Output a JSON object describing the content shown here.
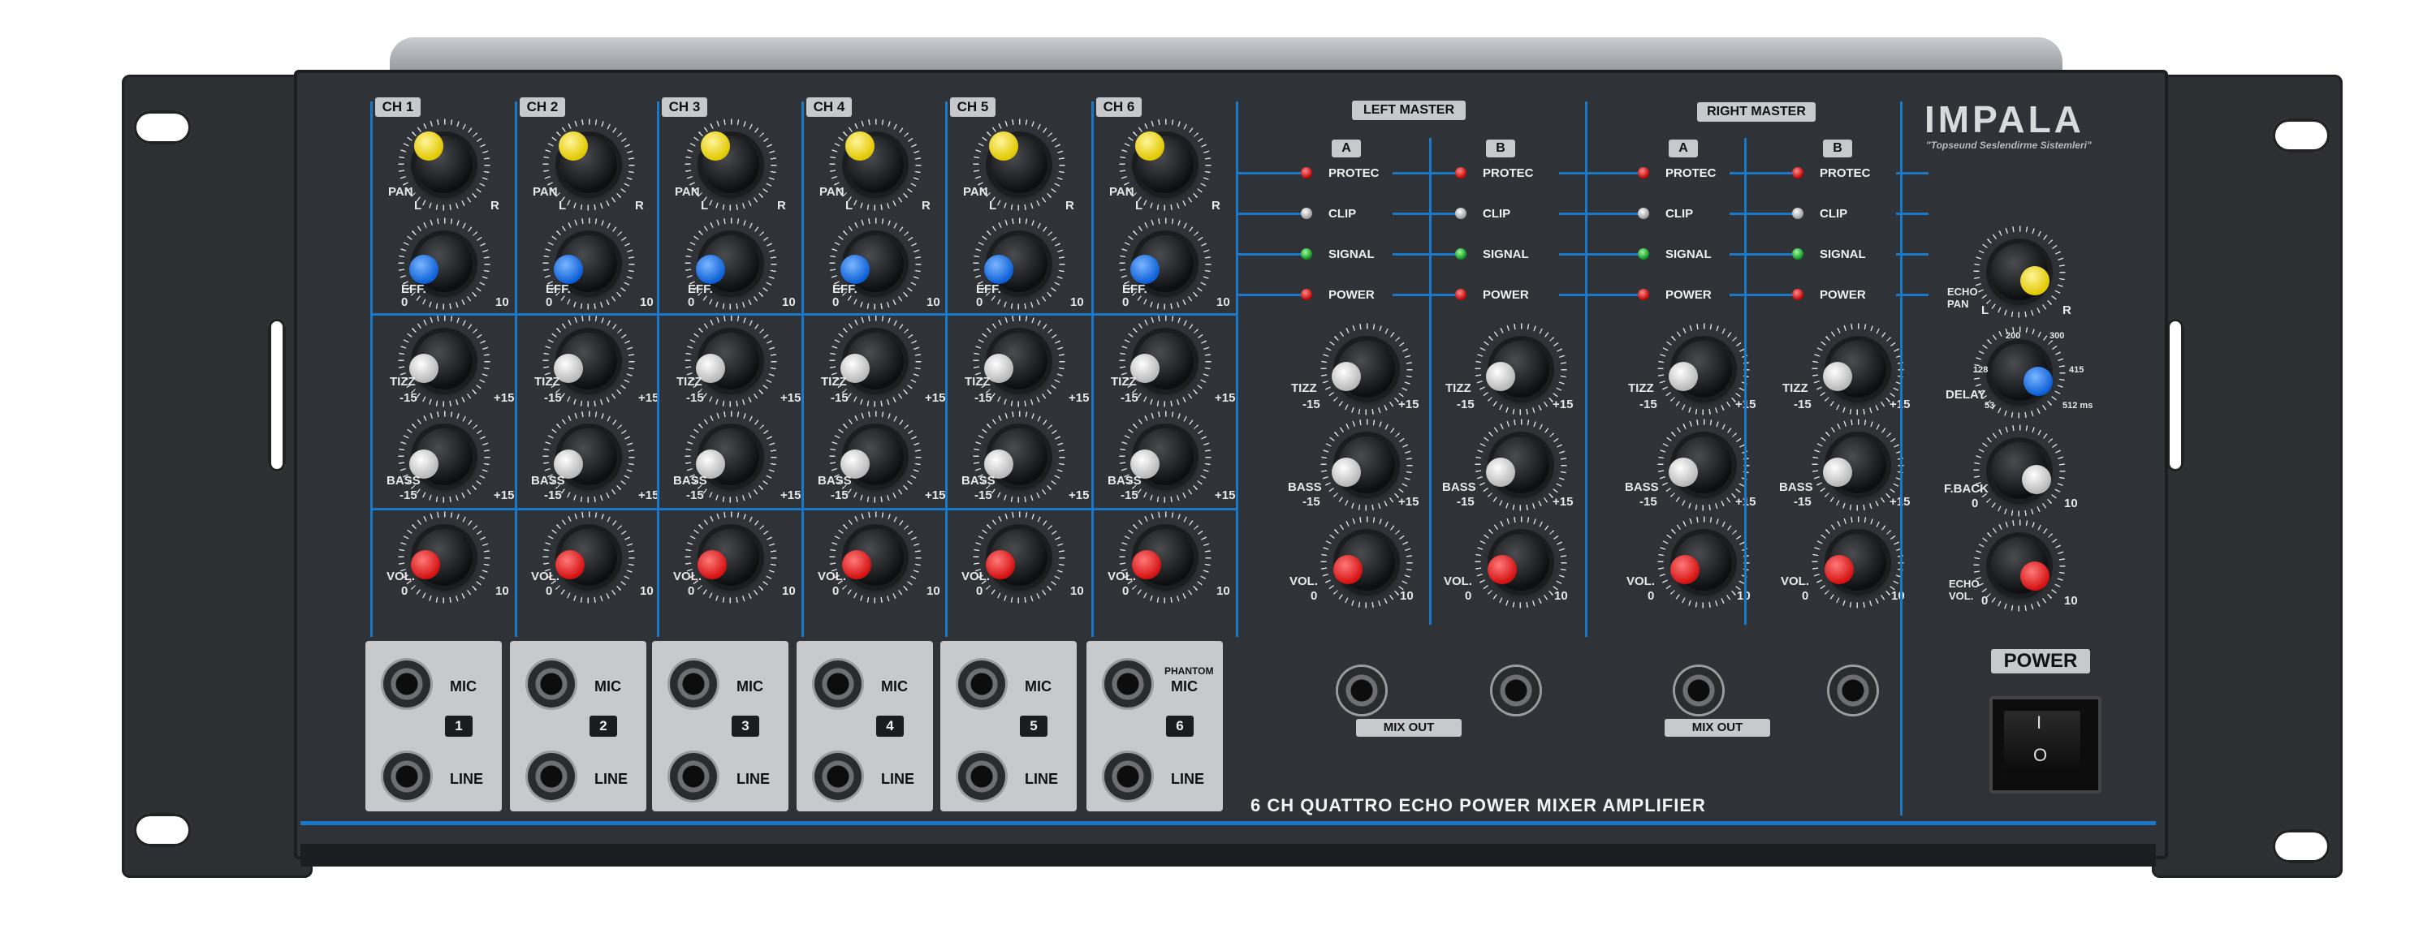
{
  "brand": {
    "name": "IMPALA",
    "tagline": "\"Topseund Seslendirme Sistemleri\""
  },
  "model_label": "6 CH QUATTRO ECHO POWER MIXER AMPLIFIER",
  "colors": {
    "panel": "#2f3236",
    "accent_blue": "#1a78c8",
    "label_plate": "#c7c9cc"
  },
  "channels": [
    {
      "label": "CH 1",
      "number": "1"
    },
    {
      "label": "CH 2",
      "number": "2"
    },
    {
      "label": "CH 3",
      "number": "3"
    },
    {
      "label": "CH 4",
      "number": "4"
    },
    {
      "label": "CH 5",
      "number": "5"
    },
    {
      "label": "CH 6",
      "number": "6"
    }
  ],
  "channel_controls": {
    "pan": "PAN",
    "pan_left": "L",
    "pan_right": "R",
    "eff": "EFF.",
    "eff_min": "0",
    "eff_max": "10",
    "tizz": "TIZZ",
    "bass": "BASS",
    "eq_min": "-15",
    "eq_max": "+15",
    "vol": "VOL.",
    "vol_min": "0",
    "vol_max": "10"
  },
  "inputs": {
    "mic": "MIC",
    "line": "LINE",
    "phantom": "PHANTOM"
  },
  "masters": {
    "left": "LEFT MASTER",
    "right": "RIGHT MASTER",
    "sections": [
      "A",
      "B",
      "A",
      "B"
    ],
    "leds": [
      "PROTEC",
      "CLIP",
      "SIGNAL",
      "POWER"
    ],
    "mix_out": "MIX OUT"
  },
  "echo": {
    "pan_label": "ECHO\nPAN",
    "pan_left": "L",
    "pan_right": "R",
    "delay": "DELAY",
    "delay_marks": [
      "53",
      "128",
      "200",
      "300",
      "415",
      "512 ms"
    ],
    "fback": "F.BACK",
    "echo_vol": "ECHO\nVOL.",
    "min": "0",
    "max": "10"
  },
  "power": {
    "label": "POWER",
    "off": "O",
    "on": "I"
  }
}
